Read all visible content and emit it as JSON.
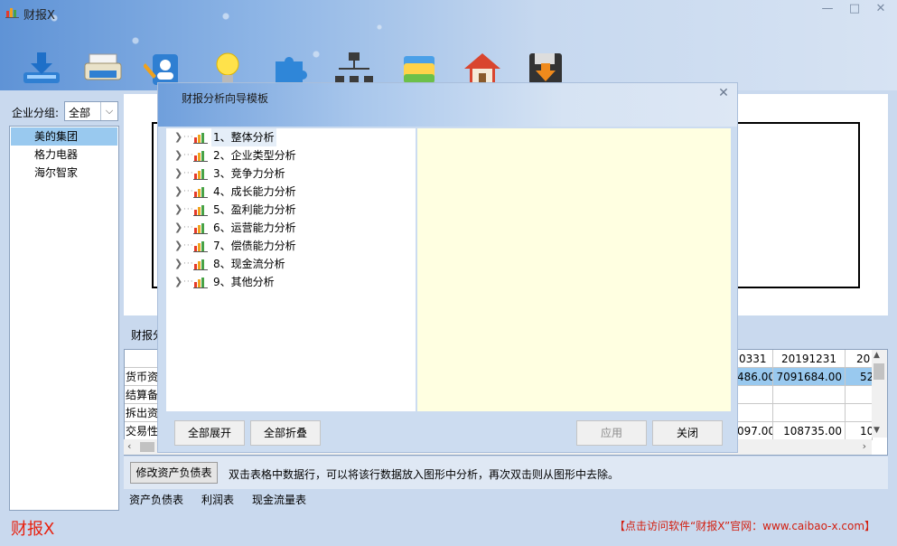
{
  "app": {
    "title": "财报X",
    "brand": "财报X",
    "visit_link": "【点击访问软件“财报X”官网：www.caibao-x.com】"
  },
  "window_controls": {
    "minimize": "—",
    "maximize": "□",
    "close": "✕"
  },
  "toolbar": [
    {
      "icon": "download-icon"
    },
    {
      "icon": "printer-icon"
    },
    {
      "icon": "contact-edit-icon"
    },
    {
      "icon": "lightbulb-icon"
    },
    {
      "icon": "puzzle-icon"
    },
    {
      "icon": "org-chart-icon"
    },
    {
      "icon": "folder-icon"
    },
    {
      "icon": "home-icon"
    },
    {
      "icon": "save-icon"
    }
  ],
  "sidebar": {
    "group_label": "企业分组:",
    "group_value": "全部",
    "companies": [
      "美的集团",
      "格力电器",
      "海尔智家"
    ]
  },
  "financial_label": "财报分",
  "grid": {
    "columns": [
      "0331",
      "20191231",
      "20"
    ],
    "rows": [
      {
        "label": "货币资",
        "values": [
          "486.00",
          "7091684.00",
          "52"
        ],
        "highlight": true
      },
      {
        "label": "结算备",
        "values": [
          "",
          "",
          ""
        ]
      },
      {
        "label": "拆出资",
        "values": [
          "",
          "",
          ""
        ]
      },
      {
        "label": "交易性",
        "values": [
          "097.00",
          "108735.00",
          "10"
        ]
      }
    ]
  },
  "bottom": {
    "edit_button": "修改资产负债表",
    "hint": "双击表格中数据行，可以将该行数据放入图形中分析，再次双击则从图形中去除。"
  },
  "sheet_tabs": [
    "资产负债表",
    "利润表",
    "现金流量表"
  ],
  "dialog": {
    "title": "财报分析向导模板",
    "close": "✕",
    "tree": [
      "1、整体分析",
      "2、企业类型分析",
      "3、竞争力分析",
      "4、成长能力分析",
      "5、盈利能力分析",
      "6、运营能力分析",
      "7、偿债能力分析",
      "8、现金流分析",
      "9、其他分析"
    ],
    "buttons": {
      "expand_all": "全部展开",
      "collapse_all": "全部折叠",
      "apply": "应用",
      "close": "关闭"
    }
  }
}
